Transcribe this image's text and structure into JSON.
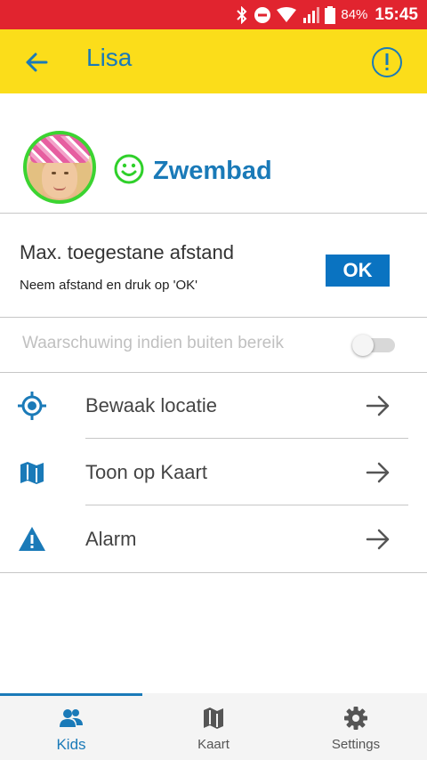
{
  "status_bar": {
    "battery_percent": "84%",
    "time": "15:45",
    "icons": [
      "bluetooth-icon",
      "do-not-disturb-icon",
      "wifi-icon",
      "signal-icon",
      "battery-icon"
    ]
  },
  "app_bar": {
    "title": "Lisa",
    "back_icon": "arrow-left-icon",
    "info_icon": "info-circle-icon",
    "background_color": "#fbdd1a",
    "title_color": "#1a7ab8"
  },
  "profile": {
    "place_name": "Zwembad",
    "place_icon": "smiley-icon",
    "avatar_ring_color": "#3bd431"
  },
  "distance": {
    "title": "Max. toegestane afstand",
    "subtitle": "Neem afstand en druk op 'OK'",
    "ok_label": "OK"
  },
  "warning": {
    "label": "Waarschuwing indien buiten bereik",
    "enabled": false
  },
  "menu": [
    {
      "label": "Bewaak locatie",
      "icon": "location-target-icon"
    },
    {
      "label": "Toon op Kaart",
      "icon": "map-icon"
    },
    {
      "label": "Alarm",
      "icon": "warning-triangle-icon"
    }
  ],
  "bottom_nav": {
    "items": [
      {
        "label": "Kids",
        "icon": "kids-icon",
        "active": true
      },
      {
        "label": "Kaart",
        "icon": "map-icon",
        "active": false
      },
      {
        "label": "Settings",
        "icon": "gear-icon",
        "active": false
      }
    ],
    "accent_color": "#1a7ab8"
  }
}
